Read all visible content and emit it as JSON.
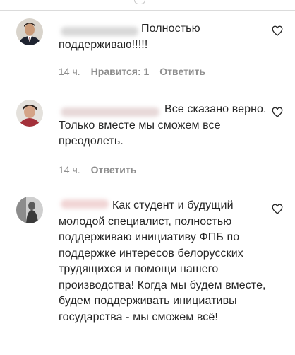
{
  "comments": [
    {
      "text": "Полностью поддерживаю!!!!!",
      "time": "14 ч.",
      "likes_label": "Нравится: 1",
      "reply_label": "Ответить",
      "heart_icon": "heart-outline-icon"
    },
    {
      "text": "Все сказано верно. Только вместе мы сможем все преодолеть.",
      "time": "14 ч.",
      "reply_label": "Ответить",
      "heart_icon": "heart-outline-icon"
    },
    {
      "text": "Как студент и будущий молодой специалист, полностью поддерживаю инициативу ФПБ по поддержке интересов белорусских трудящихся и помощи нашего производства! Когда мы будем вместе, будем поддерживать инициативы государства - мы сможем всё!",
      "heart_icon": "heart-outline-icon"
    }
  ],
  "colors": {
    "text": "#262626",
    "meta": "#8e8e8e",
    "divider": "#dbdbdb"
  }
}
